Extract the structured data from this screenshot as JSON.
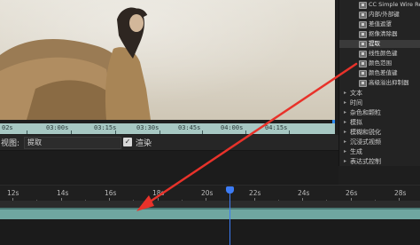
{
  "effects_list": {
    "items": [
      {
        "label": "CC Simple Wire Removal",
        "highlighted": false
      },
      {
        "label": "内部/外部键",
        "highlighted": false
      },
      {
        "label": "差值遮罩",
        "highlighted": false
      },
      {
        "label": "抠像清除器",
        "highlighted": false
      },
      {
        "label": "提取",
        "highlighted": true
      },
      {
        "label": "线性颜色键",
        "highlighted": false
      },
      {
        "label": "颜色范围",
        "highlighted": false
      },
      {
        "label": "颜色差值键",
        "highlighted": false
      },
      {
        "label": "高级溢出抑制器",
        "highlighted": false
      }
    ],
    "categories": [
      "文本",
      "时间",
      "杂色和颗粒",
      "模拟",
      "模糊和锐化",
      "沉浸式视频",
      "生成",
      "表达式控制"
    ]
  },
  "preview_ruler": {
    "labels": [
      "02s",
      "03:00s",
      "03:15s",
      "03:30s",
      "03:45s",
      "04:00s",
      "04:15s"
    ]
  },
  "viewbar": {
    "view_label": "视图:",
    "view_value": "提取",
    "render_checked": true,
    "render_label": "渲染",
    "check_glyph": "✓",
    "chevron": "⌄"
  },
  "timeline": {
    "ruler_labels": [
      "12s",
      "14s",
      "16s",
      "18s",
      "20s",
      "22s",
      "24s",
      "26s",
      "28s"
    ],
    "playhead_color": "#3d7cf5"
  },
  "annotation": {
    "arrow_color": "#e8322a"
  }
}
